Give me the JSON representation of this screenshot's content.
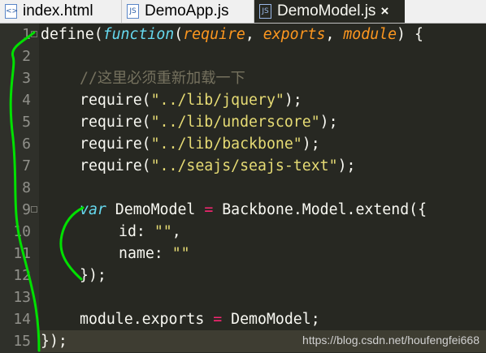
{
  "tabs": [
    {
      "label": "index.html",
      "icon": "html-file-icon",
      "icon_glyph": "<>",
      "active": false
    },
    {
      "label": "DemoApp.js",
      "icon": "js-file-icon",
      "icon_glyph": "JS",
      "active": false
    },
    {
      "label": "DemoModel.js",
      "icon": "js-file-icon",
      "icon_glyph": "JS",
      "active": true,
      "close_glyph": "×"
    }
  ],
  "line_numbers": [
    "1",
    "2",
    "3",
    "4",
    "5",
    "6",
    "7",
    "8",
    "9",
    "10",
    "11",
    "12",
    "13",
    "14",
    "15"
  ],
  "code": {
    "l1": {
      "t1": "define(",
      "t2": "function",
      "t3": "(",
      "t4": "require",
      "t5": ", ",
      "t6": "exports",
      "t7": ", ",
      "t8": "module",
      "t9": ") {"
    },
    "l3": {
      "comment": "//这里必须重新加载一下"
    },
    "l4": {
      "a": "require(",
      "b": "\"../lib/jquery\"",
      "c": ");"
    },
    "l5": {
      "a": "require(",
      "b": "\"../lib/underscore\"",
      "c": ");"
    },
    "l6": {
      "a": "require(",
      "b": "\"../lib/backbone\"",
      "c": ");"
    },
    "l7": {
      "a": "require(",
      "b": "\"../seajs/seajs-text\"",
      "c": ");"
    },
    "l9": {
      "a": "var",
      "b": " DemoModel ",
      "c": "=",
      "d": " Backbone.Model.extend({"
    },
    "l10": {
      "a": "id: ",
      "b": "\"\"",
      "c": ","
    },
    "l11": {
      "a": "name: ",
      "b": "\"\""
    },
    "l12": {
      "a": "});"
    },
    "l14": {
      "a": "module.exports ",
      "b": "=",
      "c": " DemoModel;"
    },
    "l15": {
      "a": "});"
    }
  },
  "colors": {
    "editor_bg": "#272822",
    "keyword": "#66d9ef",
    "param": "#fd971f",
    "string": "#e6db74",
    "comment": "#75715e",
    "operator": "#f92672",
    "annotation": "#00e000"
  },
  "watermark": "https://blog.csdn.net/houfengfei668"
}
